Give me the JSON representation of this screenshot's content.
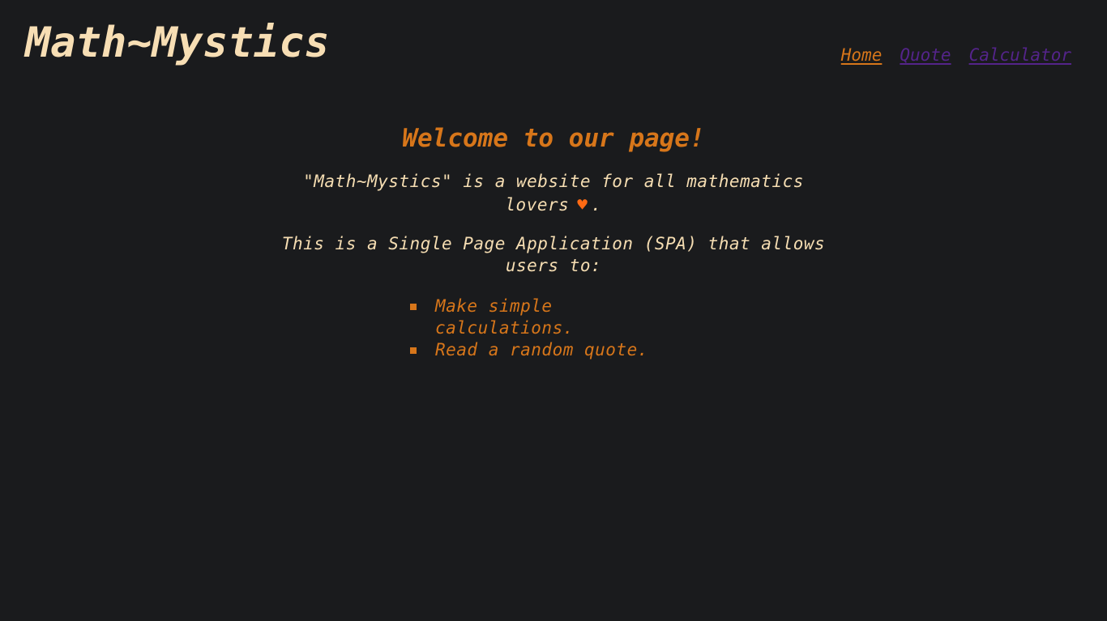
{
  "brand": {
    "title": "Math~Mystics"
  },
  "nav": {
    "items": [
      {
        "label": "Home",
        "state": "active",
        "color": "#d7761a"
      },
      {
        "label": "Quote",
        "state": "visited",
        "color": "#54248a"
      },
      {
        "label": "Calculator",
        "state": "visited",
        "color": "#54248a"
      }
    ]
  },
  "main": {
    "heading": "Welcome to our page!",
    "intro_text": "\"Math~Mystics\" is a website for all mathematics lovers",
    "intro_icon": "heart-icon",
    "intro_end": ".",
    "spa_text": "This is a Single Page Application (SPA) that allows users to:",
    "features": [
      "Make simple calculations.",
      "Read a random quote."
    ]
  },
  "colors": {
    "background": "#1a1b1d",
    "accent": "#d7761a",
    "text": "#f5ddb2",
    "heart": "#ff6a13"
  }
}
